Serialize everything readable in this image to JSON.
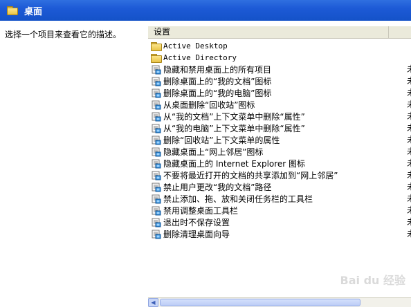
{
  "window": {
    "title": "桌面",
    "title_icon": "folder-icon",
    "title_bar_color": "#1f5ad6"
  },
  "left_pane": {
    "description": "选择一个项目来查看它的描述。"
  },
  "list": {
    "columns": [
      "设置",
      ""
    ],
    "items": [
      {
        "type": "folder",
        "icon": "folder-icon",
        "label": "Active Desktop",
        "state": ""
      },
      {
        "type": "folder",
        "icon": "folder-icon",
        "label": "Active Directory",
        "state": ""
      },
      {
        "type": "policy",
        "icon": "policy-setting-icon",
        "label": "隐藏和禁用桌面上的所有项目",
        "state": "未"
      },
      {
        "type": "policy",
        "icon": "policy-setting-icon",
        "label": "删除桌面上的“我的文档”图标",
        "state": "未"
      },
      {
        "type": "policy",
        "icon": "policy-setting-icon",
        "label": "删除桌面上的“我的电脑”图标",
        "state": "未"
      },
      {
        "type": "policy",
        "icon": "policy-setting-icon",
        "label": "从桌面删除“回收站”图标",
        "state": "未"
      },
      {
        "type": "policy",
        "icon": "policy-setting-icon",
        "label": "从“我的文档”上下文菜单中删除“属性”",
        "state": "未"
      },
      {
        "type": "policy",
        "icon": "policy-setting-icon",
        "label": "从“我的电脑”上下文菜单中删除“属性”",
        "state": "未"
      },
      {
        "type": "policy",
        "icon": "policy-setting-icon",
        "label": "删除“回收站”上下文菜单的属性",
        "state": "未"
      },
      {
        "type": "policy",
        "icon": "policy-setting-icon",
        "label": "隐藏桌面上“网上邻居”图标",
        "state": "未"
      },
      {
        "type": "policy",
        "icon": "policy-setting-icon",
        "label": "隐藏桌面上的 Internet Explorer 图标",
        "state": "未"
      },
      {
        "type": "policy",
        "icon": "policy-setting-icon",
        "label": "不要将最近打开的文档的共享添加到“网上邻居”",
        "state": "未"
      },
      {
        "type": "policy",
        "icon": "policy-setting-icon",
        "label": "禁止用户更改“我的文档”路径",
        "state": "未"
      },
      {
        "type": "policy",
        "icon": "policy-setting-icon",
        "label": "禁止添加、拖、放和关闭任务栏的工具栏",
        "state": "未"
      },
      {
        "type": "policy",
        "icon": "policy-setting-icon",
        "label": "禁用调整桌面工具栏",
        "state": "未"
      },
      {
        "type": "policy",
        "icon": "policy-setting-icon",
        "label": "退出时不保存设置",
        "state": "未"
      },
      {
        "type": "policy",
        "icon": "policy-setting-icon",
        "label": "删除清理桌面向导",
        "state": "未"
      }
    ]
  },
  "watermark": "Bai du 经验"
}
